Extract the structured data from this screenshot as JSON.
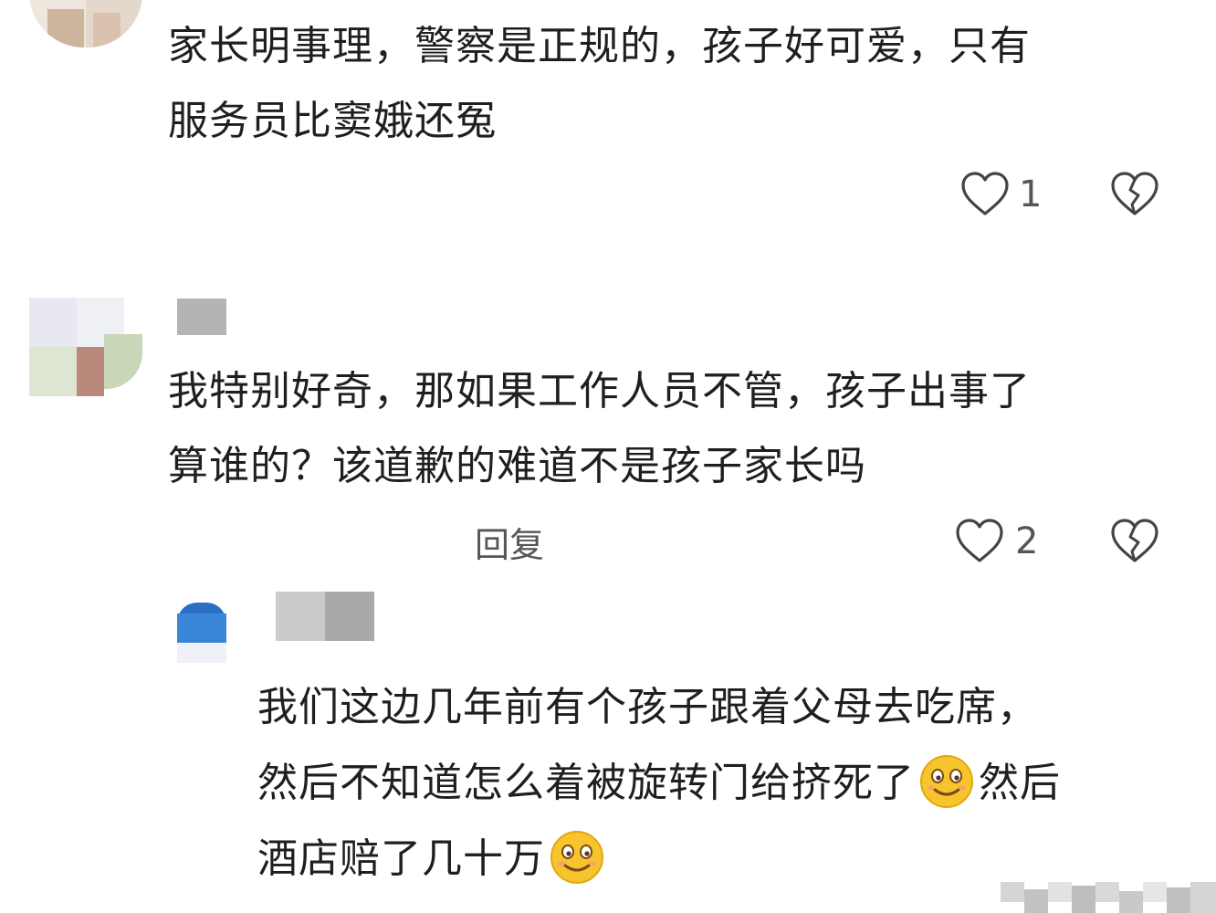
{
  "comments": [
    {
      "lines": [
        "家长明事理，警察是正规的，孩子好可爱，只有",
        "服务员比窦娥还冤"
      ],
      "like_count": "1"
    },
    {
      "lines": [
        "我特别好奇，那如果工作人员不管，孩子出事了",
        "算谁的？该道歉的难道不是孩子家长吗"
      ],
      "reply_label": "回复",
      "like_count": "2"
    }
  ],
  "reply": {
    "line1": "我们这边几年前有个孩子跟着父母去吃席，",
    "line2_a": "然后不知道怎么着被旋转门给挤死了",
    "line2_b": "然后",
    "line3": "酒店赔了几十万",
    "emoji_icon": "smiling-face-icon"
  },
  "colors": {
    "text": "#1f1f1f",
    "icon": "#444444",
    "emoji_fill": "#f7c42d"
  }
}
